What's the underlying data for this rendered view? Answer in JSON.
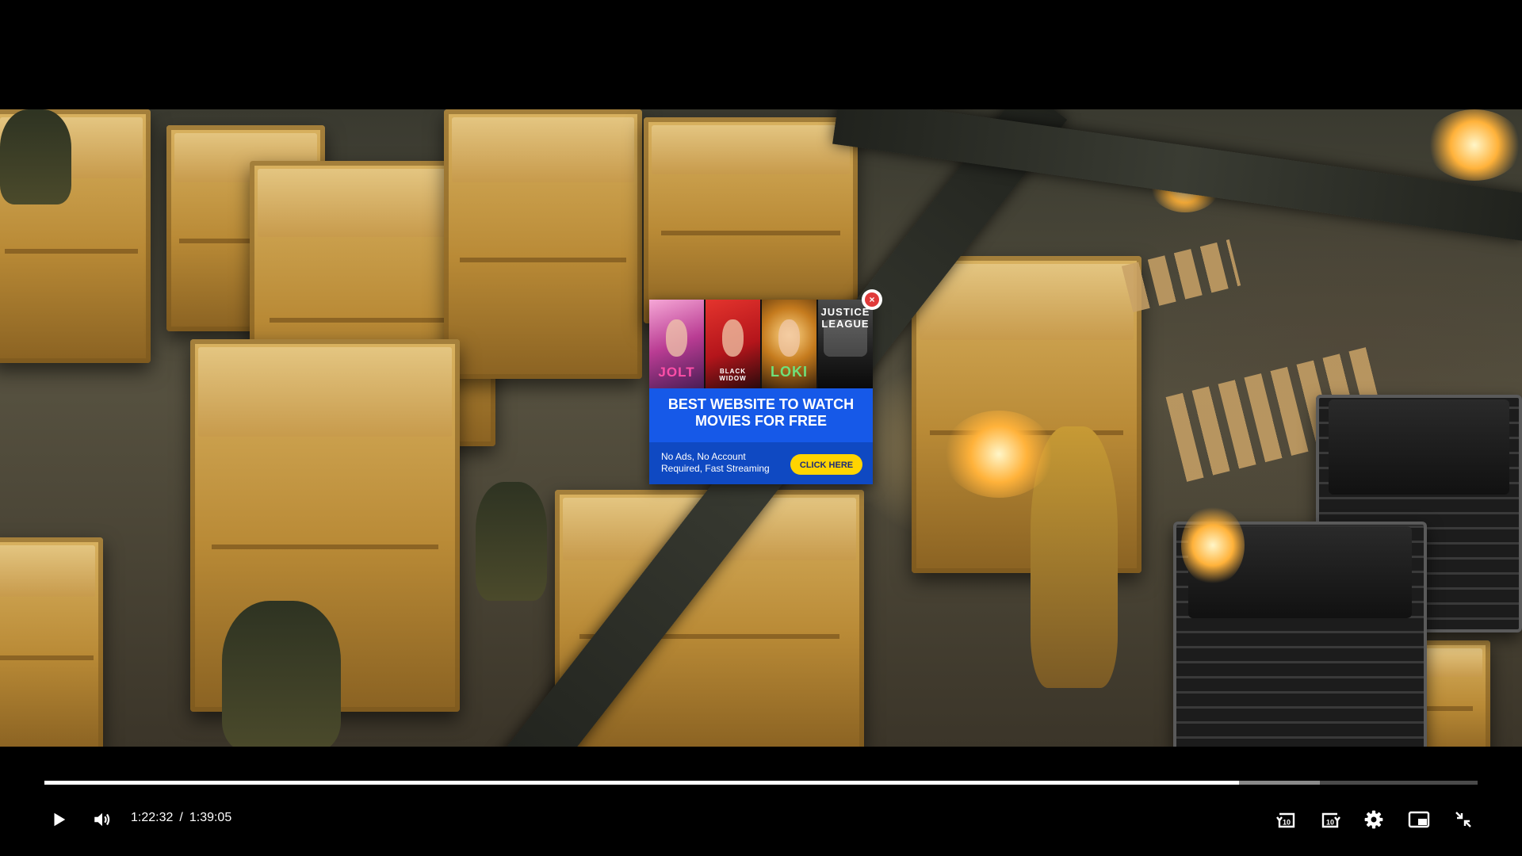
{
  "ad": {
    "posters": [
      {
        "name": "poster-1",
        "text": "JOLT"
      },
      {
        "name": "poster-2",
        "text": "BLACK WIDOW"
      },
      {
        "name": "poster-3",
        "text": "LOKI"
      },
      {
        "name": "poster-4",
        "text": "JUSTICE LEAGUE"
      }
    ],
    "headline": "BEST WEBSITE TO WATCH MOVIES FOR FREE",
    "subtext": "No Ads, No Account Required, Fast Streaming",
    "cta_label": "CLICK HERE",
    "close_glyph": "×",
    "colors": {
      "background": "#1659e8",
      "cta": "#ffd400",
      "close": "#e03a3a"
    }
  },
  "player": {
    "current_time": "1:22:32",
    "separator": "/",
    "duration": "1:39:05",
    "played_fraction": 0.8335,
    "buffered_fraction": 0.89,
    "icons": {
      "play": "play-icon",
      "volume": "volume-icon",
      "rewind": "rewind-10-icon",
      "forward": "forward-10-icon",
      "settings": "gear-icon",
      "pip": "picture-in-picture-icon",
      "fullscreen": "exit-fullscreen-icon"
    },
    "skip_seconds": "10"
  }
}
